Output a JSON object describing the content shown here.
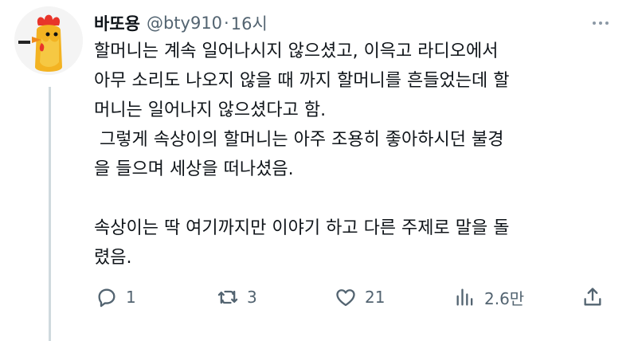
{
  "tweet": {
    "display_name": "바또용",
    "handle": "@bty910",
    "separator": "·",
    "time": "16시",
    "lines": [
      "할머니는 계속 일어나시지 않으셨고, 이윽고 라디오에서",
      "아무 소리도 나오지 않을 때 까지 할머니를 흔들었는데 할",
      "머니는 일어나지 않으셨다고 함.",
      " 그렇게 속상이의 할머니는 아주 조용히 좋아하시던 불경",
      "을 들으며 세상을 떠나셨음.",
      "",
      "속상이는 딱 여기까지만 이야기 하고 다른 주제로 말을 돌",
      "렸음."
    ]
  },
  "actions": {
    "reply": {
      "count": "1",
      "icon": "reply-icon"
    },
    "retweet": {
      "count": "3",
      "icon": "retweet-icon"
    },
    "like": {
      "count": "21",
      "icon": "heart-icon"
    },
    "views": {
      "count": "2.6만",
      "icon": "views-icon"
    },
    "share": {
      "icon": "share-icon"
    }
  },
  "colors": {
    "text_primary": "#0f1419",
    "text_secondary": "#536471",
    "thread_line": "#cfd9de"
  }
}
